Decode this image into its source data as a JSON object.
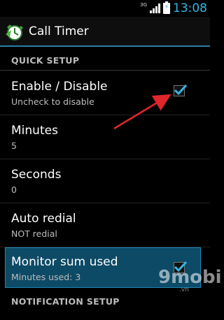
{
  "status_bar": {
    "network_type": "3G",
    "time": "13:08"
  },
  "action_bar": {
    "title": "Call Timer",
    "icon": "alarm-clock-icon"
  },
  "sections": {
    "quick_setup": "QUICK SETUP",
    "notification_setup": "NOTIFICATION SETUP"
  },
  "preferences": [
    {
      "title": "Enable / Disable",
      "summary": "Uncheck to disable",
      "checked": true
    },
    {
      "title": "Minutes",
      "summary": "5"
    },
    {
      "title": "Seconds",
      "summary": "0"
    },
    {
      "title": "Auto redial",
      "summary": "NOT redial"
    },
    {
      "title": "Monitor sum used",
      "summary": "Minutes used: 3",
      "checked": true
    }
  ],
  "colors": {
    "accent": "#33b5e5",
    "selected_bg": "#0d4a66",
    "arrow": "#e0262b"
  },
  "watermark": {
    "text": "9mobi",
    "suffix": ".vn"
  }
}
